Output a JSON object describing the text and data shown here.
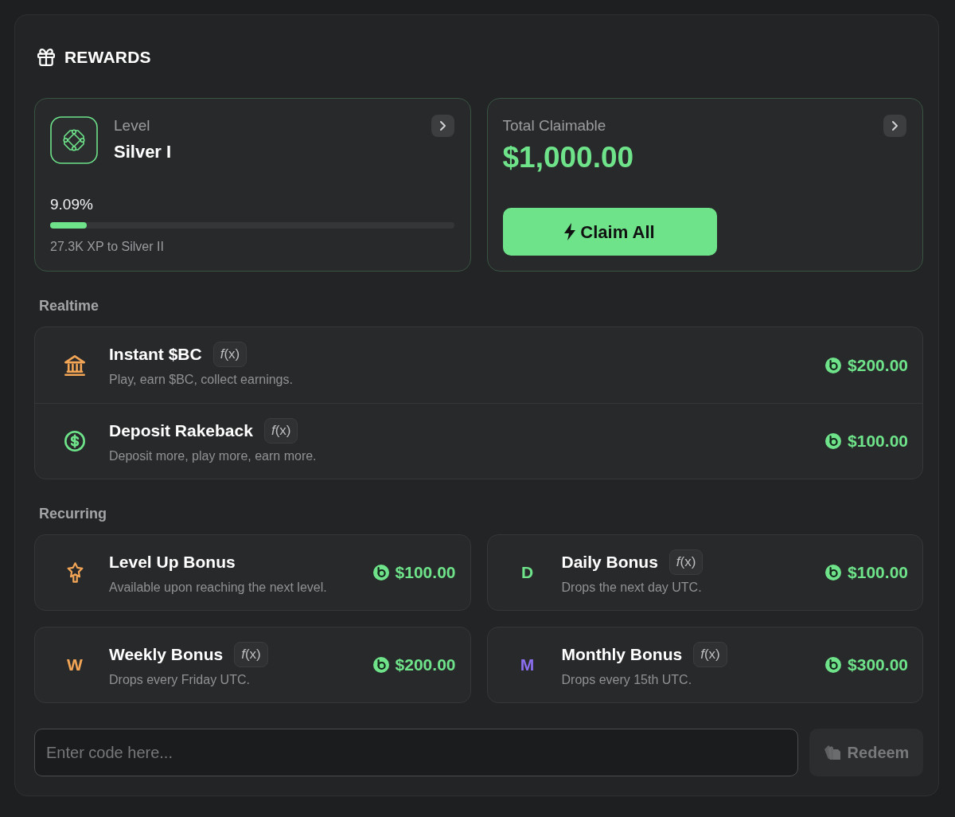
{
  "header": {
    "title": "REWARDS"
  },
  "level_card": {
    "label": "Level",
    "rank": "Silver I",
    "percent": "9.09%",
    "level": 0.0909,
    "caption": "27.3K XP to Silver II"
  },
  "claim_card": {
    "label": "Total Claimable",
    "amount": "$1,000.00",
    "button": "Claim All"
  },
  "sections": [
    {
      "title": "Realtime",
      "kind": "list",
      "items": [
        {
          "title": "Instant $BC",
          "badge": "*f*(x)",
          "description": "Play, earn $BC, collect earnings.",
          "amount": "$200.00",
          "icon": {
            "kind": "bank",
            "color": "#f3a556"
          }
        },
        {
          "title": "Deposit Rakeback",
          "badge": "*f*(x)",
          "description": "Deposit more, play more, earn more.",
          "amount": "$100.00",
          "icon": {
            "kind": "dollar",
            "color": "#6ee38a"
          }
        }
      ]
    },
    {
      "title": "Recurring",
      "kind": "grid",
      "items": [
        {
          "title": "Level Up Bonus",
          "description": "Available upon reaching the next level.",
          "amount": "$100.00",
          "icon": {
            "kind": "star",
            "color": "#f3a556"
          }
        },
        {
          "title": "Daily Bonus",
          "badge": "*f*(x)",
          "description": "Drops the next day UTC.",
          "amount": "$100.00",
          "icon": {
            "kind": "letter",
            "letter": "D",
            "color": "#6ee38a"
          }
        },
        {
          "title": "Weekly Bonus",
          "badge": "*f*(x)",
          "description": "Drops every Friday UTC.",
          "amount": "$200.00",
          "icon": {
            "kind": "letter",
            "letter": "W",
            "color": "#f3a556"
          }
        },
        {
          "title": "Monthly Bonus",
          "badge": "*f*(x)",
          "description": "Drops every 15th UTC.",
          "amount": "$300.00",
          "icon": {
            "kind": "letter",
            "letter": "M",
            "color": "#8b6ff0"
          }
        }
      ]
    }
  ],
  "code_field": {
    "placeholder": "Enter code here..."
  },
  "redeem_button": {
    "label": "Redeem",
    "disabled": true
  }
}
